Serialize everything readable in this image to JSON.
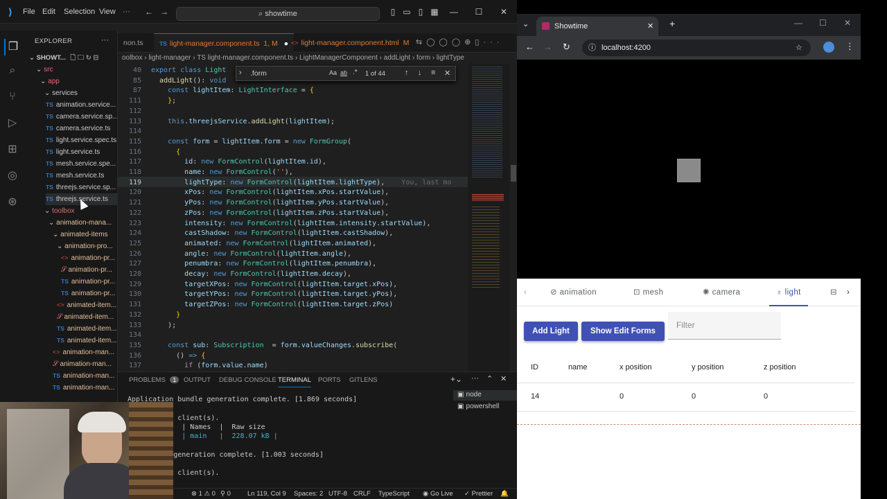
{
  "vscode": {
    "menu": [
      "File",
      "Edit",
      "Selection",
      "View"
    ],
    "command_center": "showtime",
    "explorer_title": "EXPLORER",
    "workspace": "SHOWT...",
    "tree": [
      {
        "label": "src",
        "kind": "folder"
      },
      {
        "label": "app",
        "kind": "folder"
      },
      {
        "label": "services",
        "kind": "folder"
      },
      {
        "label": "animation.service...",
        "kind": "ts"
      },
      {
        "label": "camera.service.sp...",
        "kind": "ts"
      },
      {
        "label": "camera.service.ts",
        "kind": "ts"
      },
      {
        "label": "light.service.spec.ts",
        "kind": "ts"
      },
      {
        "label": "light.service.ts",
        "kind": "ts"
      },
      {
        "label": "mesh.service.spe...",
        "kind": "ts"
      },
      {
        "label": "mesh.service.ts",
        "kind": "ts"
      },
      {
        "label": "threejs.service.sp...",
        "kind": "ts"
      },
      {
        "label": "threejs.service.ts",
        "kind": "ts"
      },
      {
        "label": "toolbox",
        "kind": "folder"
      },
      {
        "label": "animation-mana...",
        "kind": "folder"
      },
      {
        "label": "animated-items",
        "kind": "folder"
      },
      {
        "label": "animation-pro...",
        "kind": "folder"
      },
      {
        "label": "animation-pr...",
        "kind": "html"
      },
      {
        "label": "animation-pr...",
        "kind": "scss"
      },
      {
        "label": "animation-pr...",
        "kind": "ts"
      },
      {
        "label": "animation-pr...",
        "kind": "ts"
      },
      {
        "label": "animated-item...",
        "kind": "html"
      },
      {
        "label": "animated-item...",
        "kind": "scss"
      },
      {
        "label": "animated-item...",
        "kind": "ts"
      },
      {
        "label": "animated-item...",
        "kind": "ts"
      },
      {
        "label": "animation-man...",
        "kind": "html"
      },
      {
        "label": "animation-man...",
        "kind": "scss"
      },
      {
        "label": "animation-man...",
        "kind": "ts"
      },
      {
        "label": "animation-man...",
        "kind": "ts"
      }
    ],
    "tabs": [
      {
        "label": "non.ts",
        "badge": ""
      },
      {
        "label": "light-manager.component.ts",
        "badge": "1, M"
      },
      {
        "label": "light-manager.component.html",
        "badge": "M"
      }
    ],
    "breadcrumb": "oolbox › light-manager › TS light-manager.component.ts › LightManagerComponent › addLight › form › lightType",
    "find": {
      "query": ".form",
      "count": "1 of 44",
      "aa": "Aa",
      "ab": "ab",
      "re": ".*"
    },
    "code_lines": [
      {
        "n": "40",
        "html": "<span class='k'>export class</span> <span class='c'>Light</span>"
      },
      {
        "n": "85",
        "html": "  <span class='f'>addLight</span>(): <span class='k'>void</span>"
      },
      {
        "n": "87",
        "html": "    <span class='k'>const</span> <span class='v'>lightItem</span>: <span class='c'>LightInterface</span> = <span class='p'>{</span>"
      },
      {
        "n": "111",
        "html": "    <span class='p'>}</span>;"
      },
      {
        "n": "112",
        "html": ""
      },
      {
        "n": "113",
        "html": "    <span class='k'>this</span>.<span class='v'>threejsService</span>.<span class='f'>addLight</span>(<span class='v'>lightItem</span>);"
      },
      {
        "n": "114",
        "html": ""
      },
      {
        "n": "115",
        "html": "    <span class='k'>const</span> <span class='v'>form</span> = <span class='v'>lightItem</span>.<span class='v'>form</span> = <span class='k'>new</span> <span class='c'>FormGroup</span>("
      },
      {
        "n": "116",
        "html": "      <span class='p'>{</span>"
      },
      {
        "n": "117",
        "html": "        <span class='v'>id</span>: <span class='k'>new</span> <span class='c'>FormControl</span>(<span class='v'>lightItem</span>.<span class='v'>id</span>),"
      },
      {
        "n": "118",
        "html": "        <span class='v'>name</span>: <span class='k'>new</span> <span class='c'>FormControl</span>(<span class='s'>''</span>),"
      },
      {
        "n": "119",
        "html": "        <span class='v'>lightType</span>: <span class='k'>new</span> <span class='c'>FormControl</span>(<span class='v'>lightItem</span>.<span class='v'>lightType</span>),    <span class='cm'>You, last mo</span>"
      },
      {
        "n": "120",
        "html": "        <span class='v'>xPos</span>: <span class='k'>new</span> <span class='c'>FormControl</span>(<span class='v'>lightItem</span>.<span class='v'>xPos</span>.<span class='v'>startValue</span>),"
      },
      {
        "n": "121",
        "html": "        <span class='v'>yPos</span>: <span class='k'>new</span> <span class='c'>FormControl</span>(<span class='v'>lightItem</span>.<span class='v'>yPos</span>.<span class='v'>startValue</span>),"
      },
      {
        "n": "122",
        "html": "        <span class='v'>zPos</span>: <span class='k'>new</span> <span class='c'>FormControl</span>(<span class='v'>lightItem</span>.<span class='v'>zPos</span>.<span class='v'>startValue</span>),"
      },
      {
        "n": "123",
        "html": "        <span class='v'>intensity</span>: <span class='k'>new</span> <span class='c'>FormControl</span>(<span class='v'>lightItem</span>.<span class='v'>intensity</span>.<span class='v'>startValue</span>),"
      },
      {
        "n": "124",
        "html": "        <span class='v'>castShadow</span>: <span class='k'>new</span> <span class='c'>FormControl</span>(<span class='v'>lightItem</span>.<span class='v'>castShadow</span>),"
      },
      {
        "n": "125",
        "html": "        <span class='v'>animated</span>: <span class='k'>new</span> <span class='c'>FormControl</span>(<span class='v'>lightItem</span>.<span class='v'>animated</span>),"
      },
      {
        "n": "126",
        "html": "        <span class='v'>angle</span>: <span class='k'>new</span> <span class='c'>FormControl</span>(<span class='v'>lightItem</span>.<span class='v'>angle</span>),"
      },
      {
        "n": "127",
        "html": "        <span class='v'>penumbra</span>: <span class='k'>new</span> <span class='c'>FormControl</span>(<span class='v'>lightItem</span>.<span class='v'>penumbra</span>),"
      },
      {
        "n": "128",
        "html": "        <span class='v'>decay</span>: <span class='k'>new</span> <span class='c'>FormControl</span>(<span class='v'>lightItem</span>.<span class='v'>decay</span>),"
      },
      {
        "n": "129",
        "html": "        <span class='v'>targetXPos</span>: <span class='k'>new</span> <span class='c'>FormControl</span>(<span class='v'>lightItem</span>.<span class='v'>target</span>.<span class='v'>xPos</span>),"
      },
      {
        "n": "130",
        "html": "        <span class='v'>targetYPos</span>: <span class='k'>new</span> <span class='c'>FormControl</span>(<span class='v'>lightItem</span>.<span class='v'>target</span>.<span class='v'>yPos</span>),"
      },
      {
        "n": "131",
        "html": "        <span class='v'>targetZPos</span>: <span class='k'>new</span> <span class='c'>FormControl</span>(<span class='v'>lightItem</span>.<span class='v'>target</span>.<span class='v'>zPos</span>)"
      },
      {
        "n": "132",
        "html": "      <span class='p'>}</span>"
      },
      {
        "n": "133",
        "html": "    );"
      },
      {
        "n": "134",
        "html": ""
      },
      {
        "n": "135",
        "html": "    <span class='k'>const</span> <span class='v'>sub</span>: <span class='c'>Subscription</span>  = <span class='v'>form</span>.<span class='v'>valueChanges</span>.<span class='f'>subscribe</span>("
      },
      {
        "n": "136",
        "html": "      () <span class='k'>=&gt;</span> <span class='p'>{</span>"
      },
      {
        "n": "137",
        "html": "        <span class='kw'>if</span> (<span class='v'>form</span>.<span class='v'>value</span>.<span class='v'>name</span>)"
      }
    ],
    "panel_tabs": [
      "PROBLEMS",
      "OUTPUT",
      "DEBUG CONSOLE",
      "TERMINAL",
      "PORTS",
      "GITLENS"
    ],
    "problems_count": "1",
    "terminals": [
      "node",
      "powershell"
    ],
    "terminal_lines": [
      "Application bundle generation complete. [1.869 seconds]",
      "",
      "    sent to client(s).",
      "    k files  | Names  |  Raw size",
      "             | main   |  228.07 kB |",
      "",
      "    bundle generation complete. [1.003 seconds]",
      "",
      "    sent to client(s)."
    ],
    "status": {
      "errors": "⊗ 1 ⚠ 0",
      "ports": "⚲ 0",
      "position": "Ln 119, Col 9",
      "spaces": "Spaces: 2",
      "encoding": "UTF-8",
      "eol": "CRLF",
      "language": "TypeScript",
      "golive": "Go Live",
      "prettier": "Prettier"
    }
  },
  "browser": {
    "tab_title": "Showtime",
    "url": "localhost:4200",
    "app_tabs": [
      {
        "label": "animation",
        "icon": "brush-icon",
        "active": false
      },
      {
        "label": "mesh",
        "icon": "mesh-icon",
        "active": false
      },
      {
        "label": "camera",
        "icon": "camera-icon",
        "active": false
      },
      {
        "label": "light",
        "icon": "lightbulb-icon",
        "active": true
      }
    ],
    "buttons": {
      "add": "Add Light",
      "show_edit": "Show Edit Forms"
    },
    "filter_placeholder": "Filter",
    "table": {
      "headers": [
        "ID",
        "name",
        "x position",
        "y position",
        "z position"
      ],
      "rows": [
        [
          "14",
          "",
          "0",
          "0",
          "0"
        ]
      ]
    },
    "accent": "#3f51b5"
  }
}
